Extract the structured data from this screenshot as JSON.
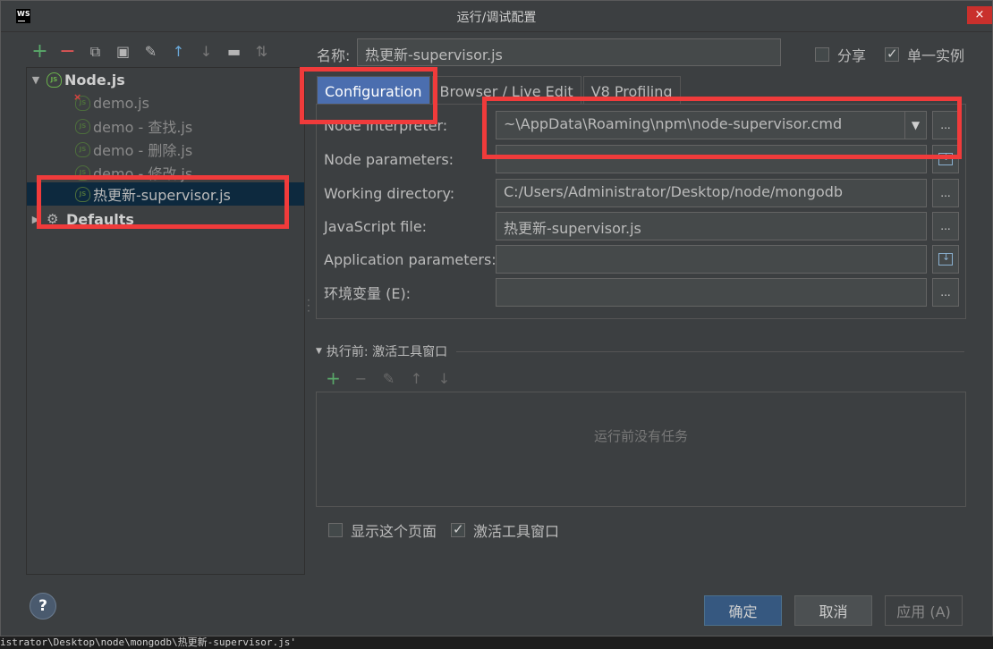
{
  "window": {
    "title": "运行/调试配置",
    "close_label": "×",
    "logo_text": "WS"
  },
  "toolbar": {
    "icons": [
      {
        "name": "add-icon",
        "glyph": "+",
        "color": "#59a869"
      },
      {
        "name": "remove-icon",
        "glyph": "−",
        "color": "#e05555"
      },
      {
        "name": "copy-icon",
        "glyph": "⧉",
        "color": "#b5b5b5"
      },
      {
        "name": "save-icon",
        "glyph": "▣",
        "color": "#b5b5b5"
      },
      {
        "name": "wrench-icon",
        "glyph": "✎",
        "color": "#b5b5b5"
      },
      {
        "name": "move-up-icon",
        "glyph": "↑",
        "color": "#6aa8d8"
      },
      {
        "name": "move-down-icon",
        "glyph": "↓",
        "color": "#7a7a7a"
      },
      {
        "name": "folder-icon",
        "glyph": "▬",
        "color": "#b5b5b5"
      },
      {
        "name": "sort-icon",
        "glyph": "⇅",
        "color": "#7a7a7a"
      }
    ]
  },
  "tree": {
    "nodejs_group": "Node.js",
    "items": [
      {
        "label": "demo.js"
      },
      {
        "label": "demo - 查找.js"
      },
      {
        "label": "demo - 删除.js"
      },
      {
        "label": "demo - 修改.js"
      },
      {
        "label": "热更新-supervisor.js"
      }
    ],
    "defaults_group": "Defaults",
    "js_icon_text": "JS"
  },
  "header": {
    "name_label": "名称:",
    "name_value": "热更新-supervisor.js",
    "share_label": "分享",
    "share_checked": false,
    "single_instance_label": "单一实例",
    "single_instance_checked": true
  },
  "tabs": [
    {
      "label": "Configuration",
      "active": true
    },
    {
      "label": "Browser / Live Edit",
      "active": false
    },
    {
      "label": "V8 Profiling",
      "active": false
    }
  ],
  "form": {
    "node_interpreter_label": "Node interpreter:",
    "node_interpreter_value": "~\\AppData\\Roaming\\npm\\node-supervisor.cmd",
    "node_parameters_label": "Node parameters:",
    "node_parameters_value": "",
    "working_directory_label": "Working directory:",
    "working_directory_value": "C:/Users/Administrator/Desktop/node/mongodb",
    "javascript_file_label": "JavaScript file:",
    "javascript_file_value": "热更新-supervisor.js",
    "application_parameters_label": "Application parameters:",
    "application_parameters_value": "",
    "env_label": "环境变量 (E):",
    "env_value": "",
    "dots": "...",
    "dropdown_arrow": "▼"
  },
  "before_launch": {
    "title": "执行前: 激活工具窗口",
    "empty_text": "运行前没有任务",
    "show_page_label": "显示这个页面",
    "show_page_checked": false,
    "activate_window_label": "激活工具窗口",
    "activate_window_checked": true
  },
  "buttons": {
    "help": "?",
    "ok": "确定",
    "cancel": "取消",
    "apply": "应用 (A)"
  },
  "background": {
    "bottom_text": "istrator\\Desktop\\node\\mongodb\\热更新-supervisor.js'"
  }
}
